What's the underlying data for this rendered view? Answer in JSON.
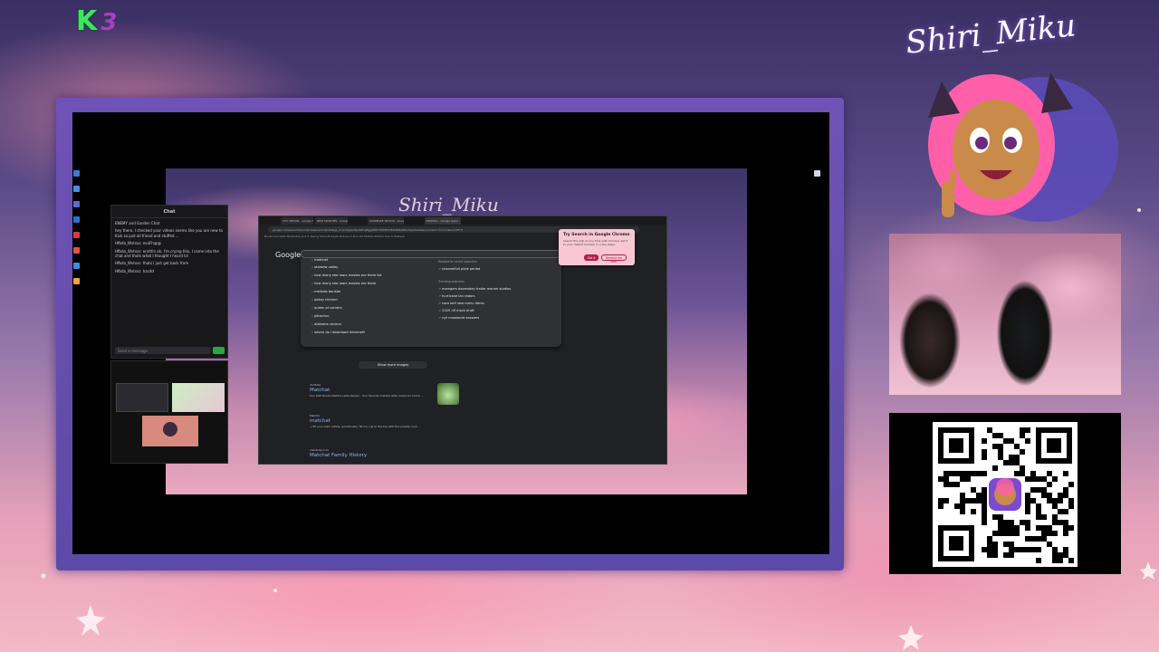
{
  "overlay": {
    "logo_letter": "K",
    "logo_number": "3",
    "brand_name": "Shiri_Miku",
    "wallpaper_signature": "Shiri_Miku"
  },
  "chat": {
    "title": "Chat",
    "input_placeholder": "Send a message",
    "messages": [
      {
        "user": "",
        "text": "ENEMY and Garden Chat"
      },
      {
        "user": "",
        "text": "hey there, I checked your videos seems like you are new to Kick so just all friend and stuffed ..."
      },
      {
        "user": "",
        "text": "Hfbda_Wvtsss: evaFh@@"
      },
      {
        "user": "",
        "text": "Hfbda_Wvtsss: ernitfrs ok, I'm crying this, I came into the chat and thats what I thought I heard lol"
      },
      {
        "user": "",
        "text": "Hfbda_Wvtsss: thats I just get back from"
      },
      {
        "user": "",
        "text": "Hfbda_Wvtsss: hacdd"
      }
    ]
  },
  "browser": {
    "tabs": [
      "CITY DECOR - Google Sea",
      "NEW MATCHES - Google Se",
      "STARBAKE MOTOS - Goog",
      "MATCHA - Google Searc"
    ],
    "address": "google.com/search?q=matcha&oq=matcha&gs_lcrp=EgZjaHJvbWUyBggAEEUYOdIBCDE4NDRqMGo3qAIAsAIA&sourceid=chrome&ie=UTF-8",
    "bookmarks": "Books and Lists   Templates and Tr   Rising Stars   Budgets   Outreach   Kick list   Hidden Photos   Hair & Makeup",
    "google_label": "Google",
    "suggestions": [
      "matchat",
      "stardew valley",
      "how many star wars movies are there list",
      "how many star wars movies are there",
      "melinda borisbe",
      "pokay chicken",
      "queen of corners",
      "pikachuu",
      "alabama cecana",
      "where do i download minecraft"
    ],
    "related_header": "Related to recent searches",
    "related": "channelfull pixie period",
    "trending_header": "Trending searches",
    "trending": [
      "avengers doomsday trailer marvel studios",
      "hurricane ian radars",
      "taco bell new menu items",
      "2025 nfl mock draft",
      "nyt crossword answers"
    ],
    "show_more": "Show more images",
    "results": [
      {
        "source": "YouTube",
        "title": "Matchat",
        "snippet": "Iron Soft Drinks Matcha Latte Recipe - Your favorite matcha latte recipe for home ..."
      },
      {
        "source": "Matcha",
        "title": "matchat",
        "snippet": "+ fill your plain artists, emotionally, fill my cup to the top with the powder now ..."
      },
      {
        "source": "chestnity.com",
        "title": "Matchat Family History",
        "snippet": ""
      }
    ],
    "popup": {
      "title": "Try Search in Google Chrome",
      "body": "Search the web at any time with Chrome. Set it to your default browser in a few steps.",
      "accept": "Got it",
      "decline": "Remind me later"
    }
  },
  "colors": {
    "frame": "#6f52b5",
    "chat_bg": "#18181b",
    "browser_bg": "#202124",
    "popup_bg": "#f8c7d3",
    "accent_green": "#39e85f"
  }
}
